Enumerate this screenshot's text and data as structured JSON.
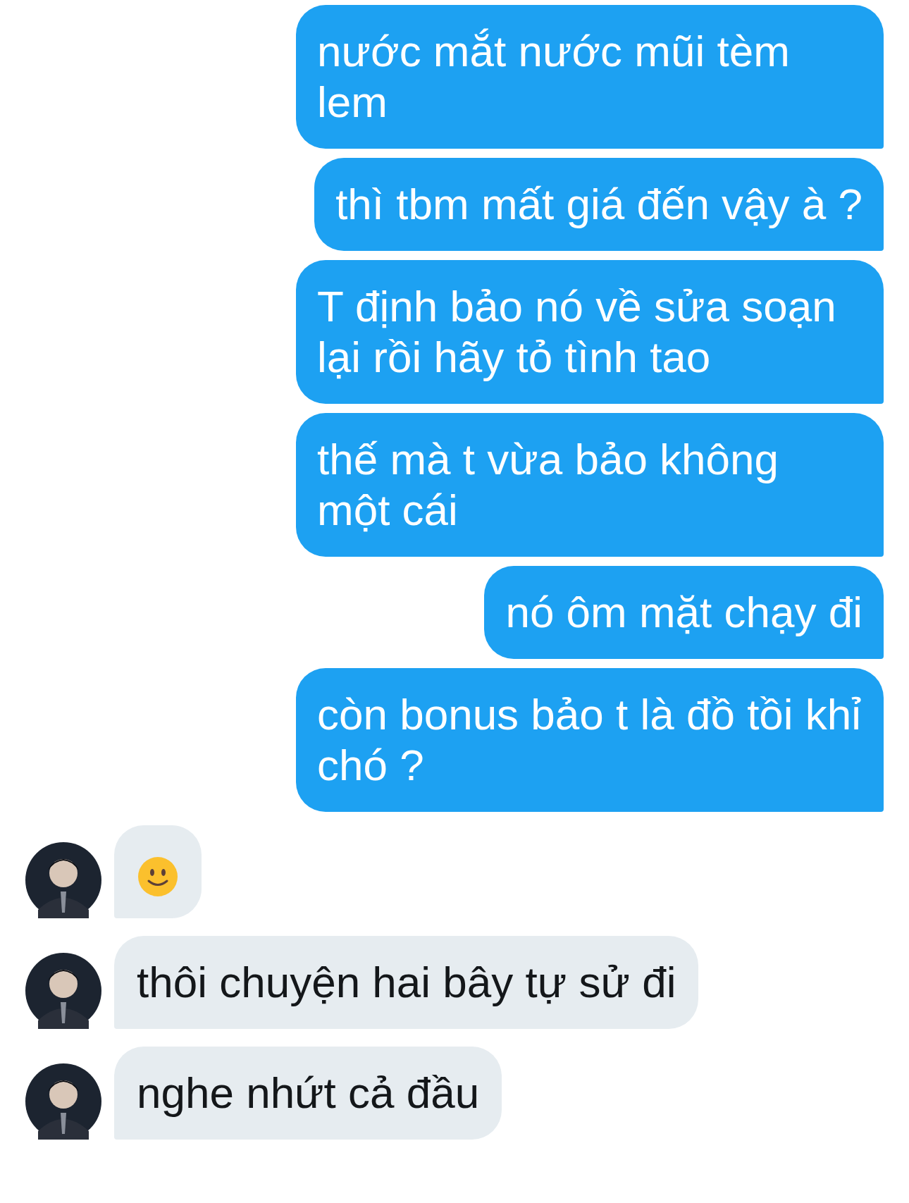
{
  "messages": [
    {
      "outgoing": true,
      "kind": "text",
      "text": "nước mắt nước mũi tèm lem"
    },
    {
      "outgoing": true,
      "kind": "text",
      "text": "thì tbm mất giá đến vậy à ?"
    },
    {
      "outgoing": true,
      "kind": "text",
      "text": "T định bảo nó về sửa soạn lại rồi hãy tỏ tình tao"
    },
    {
      "outgoing": true,
      "kind": "text",
      "text": "thế mà t vừa bảo không một cái"
    },
    {
      "outgoing": true,
      "kind": "text",
      "text": "nó ôm mặt chạy đi"
    },
    {
      "outgoing": true,
      "kind": "text",
      "text": "còn bonus bảo t là đồ tồi khỉ chó ?"
    },
    {
      "outgoing": false,
      "kind": "emoji"
    },
    {
      "outgoing": false,
      "kind": "text",
      "text": "thôi chuyện hai bây tự sử đi"
    },
    {
      "outgoing": false,
      "kind": "text",
      "text": "nghe nhứt cả đầu"
    }
  ]
}
